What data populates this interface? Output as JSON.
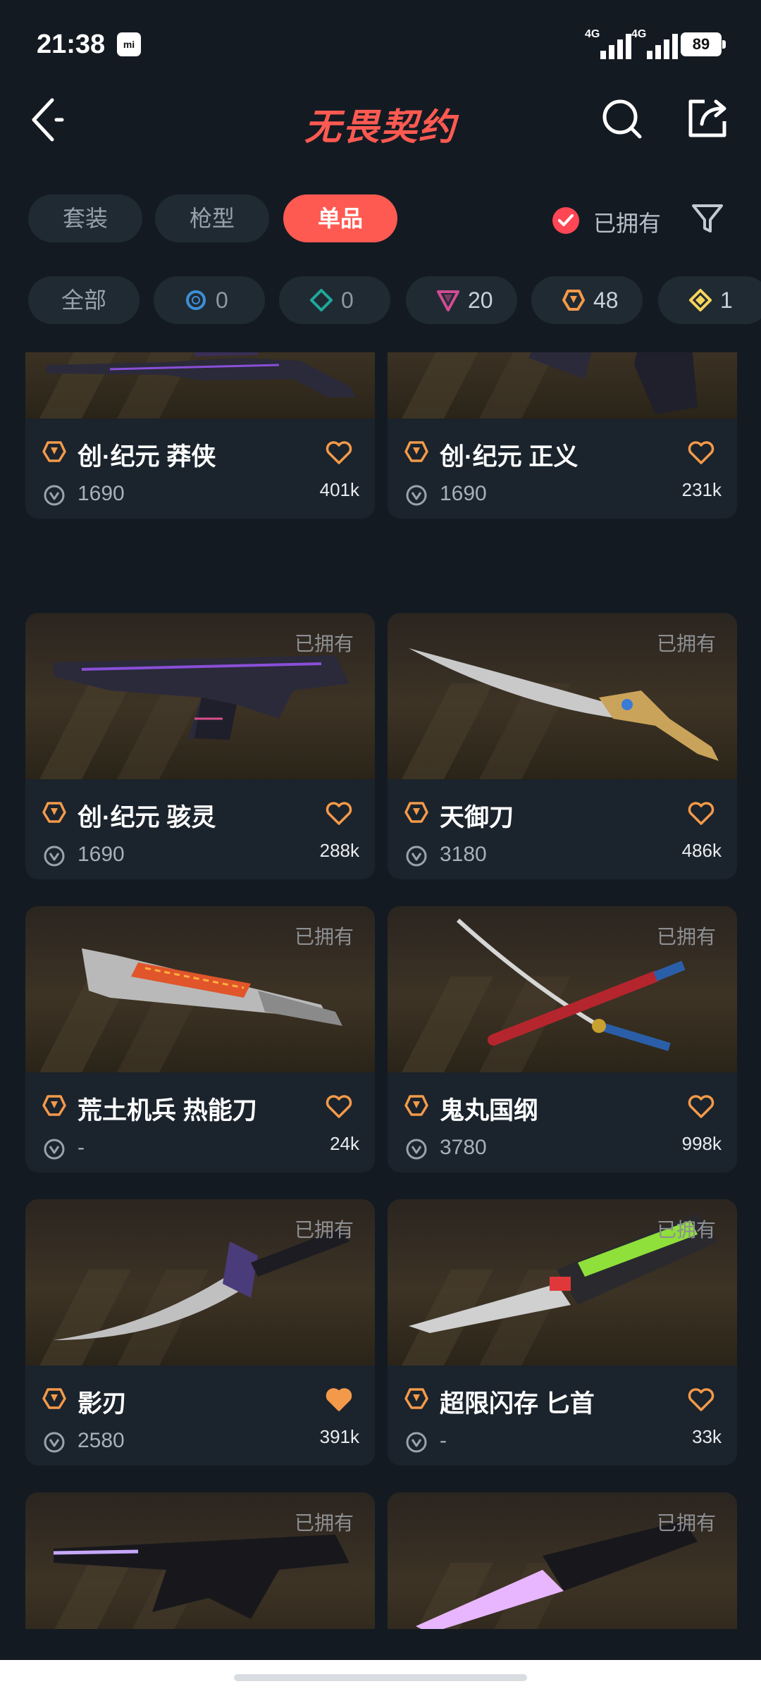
{
  "status_bar": {
    "time": "21:38",
    "mi_badge": "mi",
    "net1": "4G",
    "net2": "4G",
    "battery": "89"
  },
  "header": {
    "title": "无畏契约"
  },
  "tabs": [
    {
      "label": "套装",
      "active": false
    },
    {
      "label": "枪型",
      "active": false
    },
    {
      "label": "单品",
      "active": true
    }
  ],
  "owned_filter": {
    "label": "已拥有",
    "checked": true,
    "color": "#ff4655"
  },
  "rarity_filters": [
    {
      "label": "全部"
    },
    {
      "count": "0",
      "icon": "select-tier-icon",
      "color": "#3d8fd8"
    },
    {
      "count": "0",
      "icon": "deluxe-tier-icon",
      "color": "#1fa89a"
    },
    {
      "count": "20",
      "icon": "premium-tier-icon",
      "color": "#d04b93"
    },
    {
      "count": "48",
      "icon": "exclusive-tier-icon",
      "color": "#f39a4a"
    },
    {
      "count": "1",
      "icon": "ultra-tier-icon",
      "color": "#f7d45a"
    }
  ],
  "owned_tag": "已拥有",
  "items": [
    {
      "name": "创·纪元 莽侠",
      "price": "1690",
      "likes": "401k",
      "owned": true,
      "favorited": false,
      "weapon": "rifle"
    },
    {
      "name": "创·纪元 正义",
      "price": "1690",
      "likes": "231k",
      "owned": true,
      "favorited": false,
      "weapon": "revolver"
    },
    {
      "name": "创·纪元 骇灵",
      "price": "1690",
      "likes": "288k",
      "owned": true,
      "favorited": false,
      "weapon": "smg"
    },
    {
      "name": "天御刀",
      "price": "3180",
      "likes": "486k",
      "owned": true,
      "favorited": false,
      "weapon": "curved-blade"
    },
    {
      "name": "荒土机兵 热能刀",
      "price": "-",
      "likes": "24k",
      "owned": true,
      "favorited": false,
      "weapon": "cleaver"
    },
    {
      "name": "鬼丸国纲",
      "price": "3780",
      "likes": "998k",
      "owned": true,
      "favorited": false,
      "weapon": "katana"
    },
    {
      "name": "影刃",
      "price": "2580",
      "likes": "391k",
      "owned": true,
      "favorited": true,
      "weapon": "dagger"
    },
    {
      "name": "超限闪存 匕首",
      "price": "-",
      "likes": "33k",
      "owned": true,
      "favorited": false,
      "weapon": "tech-knife"
    },
    {
      "name": "",
      "price": "",
      "likes": "",
      "owned": true,
      "favorited": false,
      "weapon": "dark-rifle"
    },
    {
      "name": "",
      "price": "",
      "likes": "",
      "owned": true,
      "favorited": false,
      "weapon": "crystal-blade"
    }
  ],
  "accent_color": "#ff5a52",
  "tier_color": "#f39a4a"
}
